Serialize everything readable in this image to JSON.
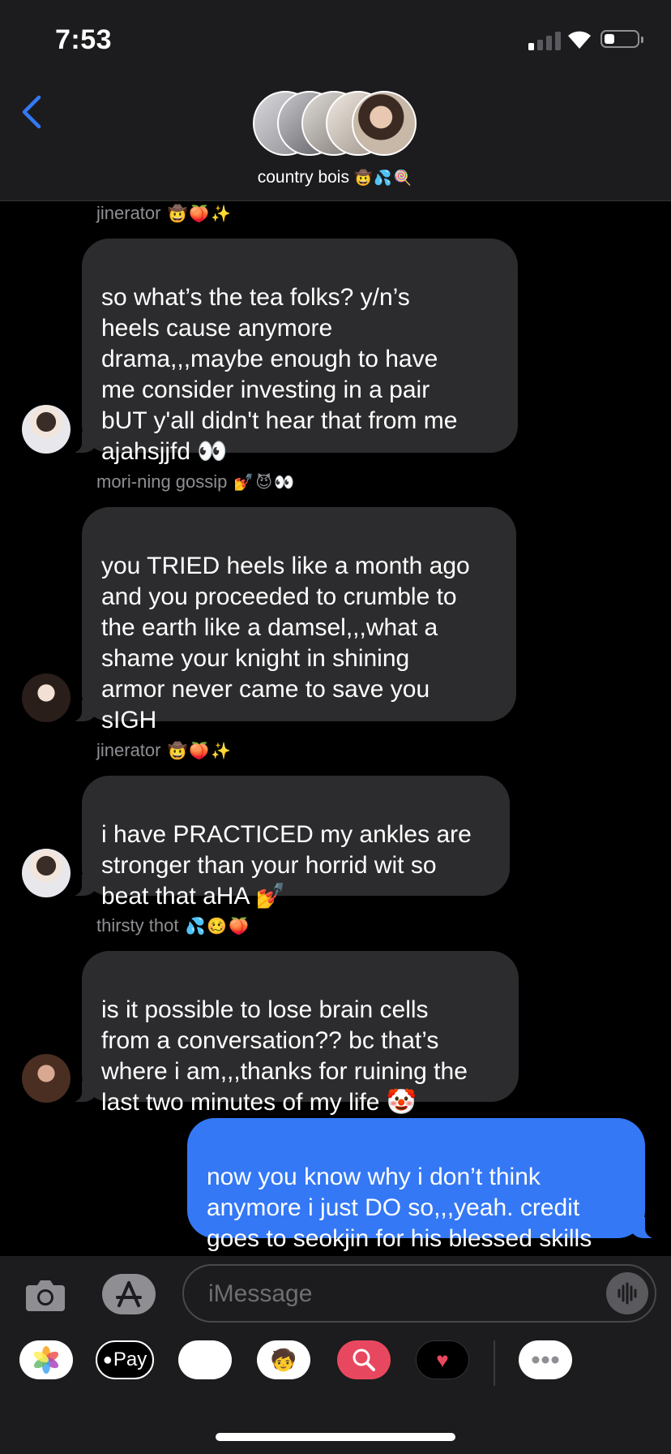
{
  "status_bar": {
    "time": "7:53"
  },
  "header": {
    "group_name": "country bois",
    "group_emoji": "🤠💦🍭"
  },
  "messages": [
    {
      "sender": "jinerator",
      "sender_emoji": "🤠🍑✨",
      "text": "so what’s the tea folks? y/n’s\nheels cause anymore\ndrama,,,maybe enough to have\nme consider investing in a pair\nbUT y'all didn't hear that from me\najahsjjfd 👀"
    },
    {
      "sender": "mori-ning gossip",
      "sender_emoji": "💅😈👀",
      "text": "you TRIED heels like a month ago\nand you proceeded to crumble to\nthe earth like a damsel,,,what a\nshame your knight in shining\narmor never came to save you\nsIGH"
    },
    {
      "sender": "jinerator",
      "sender_emoji": "🤠🍑✨",
      "text": "i have PRACTICED my ankles are\nstronger than your horrid wit so\nbeat that aHA 💅"
    },
    {
      "sender": "thirsty thot",
      "sender_emoji": "💦🥴🍑",
      "text": "is it possible to lose brain cells\nfrom a conversation?? bc that’s\nwhere i am,,,thanks for ruining the\nlast two minutes of my life 🤡"
    },
    {
      "sender": "",
      "sender_emoji": "",
      "text": "now you know why i don’t think\nanymore i just DO so,,,yeah. credit\ngoes to seokjin for his blessed skills"
    }
  ],
  "composer": {
    "placeholder": "iMessage"
  },
  "app_drawer": {
    "apple_pay_label": "Pay"
  },
  "colors": {
    "bubble_in": "#2c2c2e",
    "bubble_out": "#3478f6",
    "accent": "#3478f6"
  }
}
